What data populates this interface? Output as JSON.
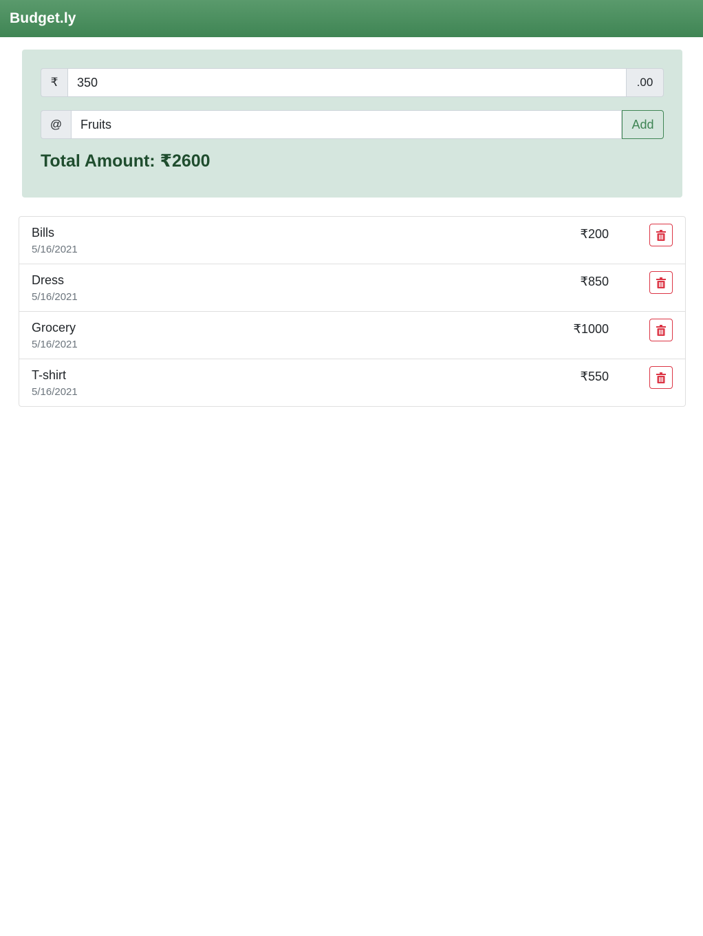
{
  "app": {
    "brand": "Budget.ly"
  },
  "form": {
    "currency_symbol": "₹",
    "amount_value": "350",
    "decimal_suffix": ".00",
    "at_symbol": "@",
    "label_value": "Fruits",
    "add_label": "Add",
    "total_text": "Total Amount: ₹2600"
  },
  "expenses": [
    {
      "name": "Bills",
      "date": "5/16/2021",
      "amount": "₹200"
    },
    {
      "name": "Dress",
      "date": "5/16/2021",
      "amount": "₹850"
    },
    {
      "name": "Grocery",
      "date": "5/16/2021",
      "amount": "₹1000"
    },
    {
      "name": "T-shirt",
      "date": "5/16/2021",
      "amount": "₹550"
    }
  ],
  "colors": {
    "brand_green": "#3f8554",
    "panel_bg": "#d5e6de",
    "danger": "#dc3545",
    "total_text": "#1f4d2e"
  },
  "icons": {
    "delete": "trash-icon"
  }
}
